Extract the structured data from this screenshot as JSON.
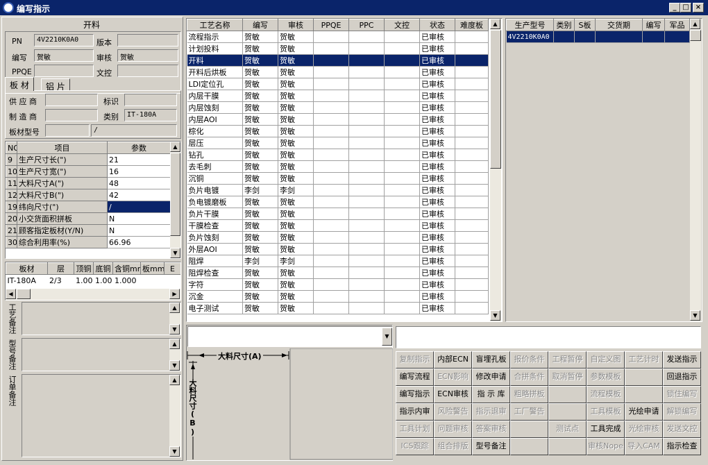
{
  "app": {
    "title": "编写指示"
  },
  "left": {
    "section_title": "开料",
    "pn_label": "PN",
    "pn_value": "4V2210K0A0",
    "version_label": "版本",
    "version_value": "",
    "writer_label": "编写",
    "writer_value": "贺敏",
    "review_label": "审核",
    "review_value": "贺敏",
    "ppqe_label": "PPQE",
    "ppqe_value": "",
    "doccontrol_label": "文控",
    "doccontrol_value": "",
    "tabs": [
      "板 材",
      "铝 片"
    ],
    "supplier_label": "供 应 商",
    "supplier_value": "",
    "mark_label": "标识",
    "mark_value": "",
    "maker_label": "制 造 商",
    "maker_value": "",
    "category_label": "类别",
    "category_value": "IT-180A",
    "model_label": "板材型号",
    "model_value": "",
    "model_value2": "/",
    "param_headers": [
      "NO",
      "项目",
      "参数"
    ],
    "params": [
      {
        "no": "9",
        "item": "生产尺寸长(\")",
        "val": "21"
      },
      {
        "no": "10",
        "item": "生产尺寸宽(\")",
        "val": "16"
      },
      {
        "no": "11",
        "item": "大料尺寸A(\")",
        "val": "48"
      },
      {
        "no": "12",
        "item": "大料尺寸B(\")",
        "val": "42"
      },
      {
        "no": "19",
        "item": "纬向尺寸(\")",
        "val": "/"
      },
      {
        "no": "20",
        "item": "小交货面积拼板",
        "val": "N"
      },
      {
        "no": "21",
        "item": "顾客指定板材(Y/N)",
        "val": "N"
      },
      {
        "no": "30",
        "item": "综合利用率(%)",
        "val": "66.96"
      }
    ],
    "mat_headers": [
      "板材",
      "层",
      "顶铜",
      "底铜",
      "含铜mm",
      "板mm",
      "E"
    ],
    "mat_row": [
      "IT-180A",
      "2/3",
      "1.00",
      "1.00",
      "1.000",
      "",
      ""
    ],
    "notes": [
      "工艺备注",
      "型号备注",
      "订单备注"
    ]
  },
  "proc": {
    "headers": [
      "工艺名称",
      "编写",
      "审核",
      "PPQE",
      "PPC",
      "文控",
      "状态",
      "难度板"
    ],
    "rows": [
      [
        "流程指示",
        "贺敏",
        "贺敏",
        "",
        "",
        "",
        "已审核",
        ""
      ],
      [
        "计划投料",
        "贺敏",
        "贺敏",
        "",
        "",
        "",
        "已审核",
        ""
      ],
      [
        "开料",
        "贺敏",
        "贺敏",
        "",
        "",
        "",
        "已审核",
        ""
      ],
      [
        "开料后烘板",
        "贺敏",
        "贺敏",
        "",
        "",
        "",
        "已审核",
        ""
      ],
      [
        "LDI定位孔",
        "贺敏",
        "贺敏",
        "",
        "",
        "",
        "已审核",
        ""
      ],
      [
        "内层干膜",
        "贺敏",
        "贺敏",
        "",
        "",
        "",
        "已审核",
        ""
      ],
      [
        "内层蚀刻",
        "贺敏",
        "贺敏",
        "",
        "",
        "",
        "已审核",
        ""
      ],
      [
        "内层AOI",
        "贺敏",
        "贺敏",
        "",
        "",
        "",
        "已审核",
        ""
      ],
      [
        "棕化",
        "贺敏",
        "贺敏",
        "",
        "",
        "",
        "已审核",
        ""
      ],
      [
        "层压",
        "贺敏",
        "贺敏",
        "",
        "",
        "",
        "已审核",
        ""
      ],
      [
        "钻孔",
        "贺敏",
        "贺敏",
        "",
        "",
        "",
        "已审核",
        ""
      ],
      [
        "去毛刺",
        "贺敏",
        "贺敏",
        "",
        "",
        "",
        "已审核",
        ""
      ],
      [
        "沉铜",
        "贺敏",
        "贺敏",
        "",
        "",
        "",
        "已审核",
        ""
      ],
      [
        "负片电镀",
        "李剑",
        "李剑",
        "",
        "",
        "",
        "已审核",
        ""
      ],
      [
        "负电镀磨板",
        "贺敏",
        "贺敏",
        "",
        "",
        "",
        "已审核",
        ""
      ],
      [
        "负片干膜",
        "贺敏",
        "贺敏",
        "",
        "",
        "",
        "已审核",
        ""
      ],
      [
        "干膜检查",
        "贺敏",
        "贺敏",
        "",
        "",
        "",
        "已审核",
        ""
      ],
      [
        "负片蚀刻",
        "贺敏",
        "贺敏",
        "",
        "",
        "",
        "已审核",
        ""
      ],
      [
        "外层AOI",
        "贺敏",
        "贺敏",
        "",
        "",
        "",
        "已审核",
        ""
      ],
      [
        "阻焊",
        "李剑",
        "李剑",
        "",
        "",
        "",
        "已审核",
        ""
      ],
      [
        "阻焊检查",
        "贺敏",
        "贺敏",
        "",
        "",
        "",
        "已审核",
        ""
      ],
      [
        "字符",
        "贺敏",
        "贺敏",
        "",
        "",
        "",
        "已审核",
        ""
      ],
      [
        "沉金",
        "贺敏",
        "贺敏",
        "",
        "",
        "",
        "已审核",
        ""
      ],
      [
        "电子测试",
        "贺敏",
        "贺敏",
        "",
        "",
        "",
        "已审核",
        ""
      ]
    ],
    "selected": 2
  },
  "right": {
    "headers": [
      "生产型号",
      "类别",
      "S板",
      "交货期",
      "编写",
      "军品"
    ],
    "rows": [
      [
        "4V2210K0A0",
        "",
        "",
        "",
        "",
        ""
      ]
    ]
  },
  "diagram": {
    "a_label": "大料尺寸(A)",
    "b_label": "大料尺寸(B)"
  },
  "buttons": [
    [
      {
        "t": "复制指示",
        "e": 0
      },
      {
        "t": "内部ECN",
        "e": 1
      },
      {
        "t": "盲埋孔板",
        "e": 1
      },
      {
        "t": "报价条件",
        "e": 0
      },
      {
        "t": "工程暂停",
        "e": 0
      },
      {
        "t": "自定义图",
        "e": 0
      },
      {
        "t": "工艺计时",
        "e": 0
      },
      {
        "t": "发送指示",
        "e": 1
      }
    ],
    [
      {
        "t": "编写流程",
        "e": 1
      },
      {
        "t": "ECN影响",
        "e": 0
      },
      {
        "t": "修改申请",
        "e": 1
      },
      {
        "t": "合拼条件",
        "e": 0
      },
      {
        "t": "取消暂停",
        "e": 0
      },
      {
        "t": "参数模板",
        "e": 0
      },
      {
        "t": "",
        "e": 0
      },
      {
        "t": "回退指示",
        "e": 1
      }
    ],
    [
      {
        "t": "编写指示",
        "e": 1
      },
      {
        "t": "ECN审核",
        "e": 1
      },
      {
        "t": "指 示 库",
        "e": 1
      },
      {
        "t": "粗略拼板",
        "e": 0
      },
      {
        "t": "",
        "e": 0
      },
      {
        "t": "流程模板",
        "e": 0
      },
      {
        "t": "",
        "e": 0
      },
      {
        "t": "锁住编写",
        "e": 0
      }
    ],
    [
      {
        "t": "指示内审",
        "e": 1
      },
      {
        "t": "风险警告",
        "e": 0
      },
      {
        "t": "指示退审",
        "e": 0
      },
      {
        "t": "工厂警告",
        "e": 0
      },
      {
        "t": "",
        "e": 0
      },
      {
        "t": "工具模板",
        "e": 0
      },
      {
        "t": "光绘申请",
        "e": 1
      },
      {
        "t": "解锁编写",
        "e": 0
      }
    ],
    [
      {
        "t": "工具计划",
        "e": 0
      },
      {
        "t": "问题审核",
        "e": 0
      },
      {
        "t": "答案审核",
        "e": 0
      },
      {
        "t": "",
        "e": 0
      },
      {
        "t": "测试点",
        "e": 0
      },
      {
        "t": "工具完成",
        "e": 1
      },
      {
        "t": "光绘审核",
        "e": 0
      },
      {
        "t": "发送文控",
        "e": 0
      }
    ],
    [
      {
        "t": "ICS跟踪",
        "e": 0
      },
      {
        "t": "组合排版",
        "e": 0
      },
      {
        "t": "型号备注",
        "e": 1
      },
      {
        "t": "",
        "e": 0
      },
      {
        "t": "",
        "e": 0
      },
      {
        "t": "审核Nope",
        "e": 0
      },
      {
        "t": "导入CAM",
        "e": 0
      },
      {
        "t": "指示检查",
        "e": 1
      }
    ]
  ]
}
